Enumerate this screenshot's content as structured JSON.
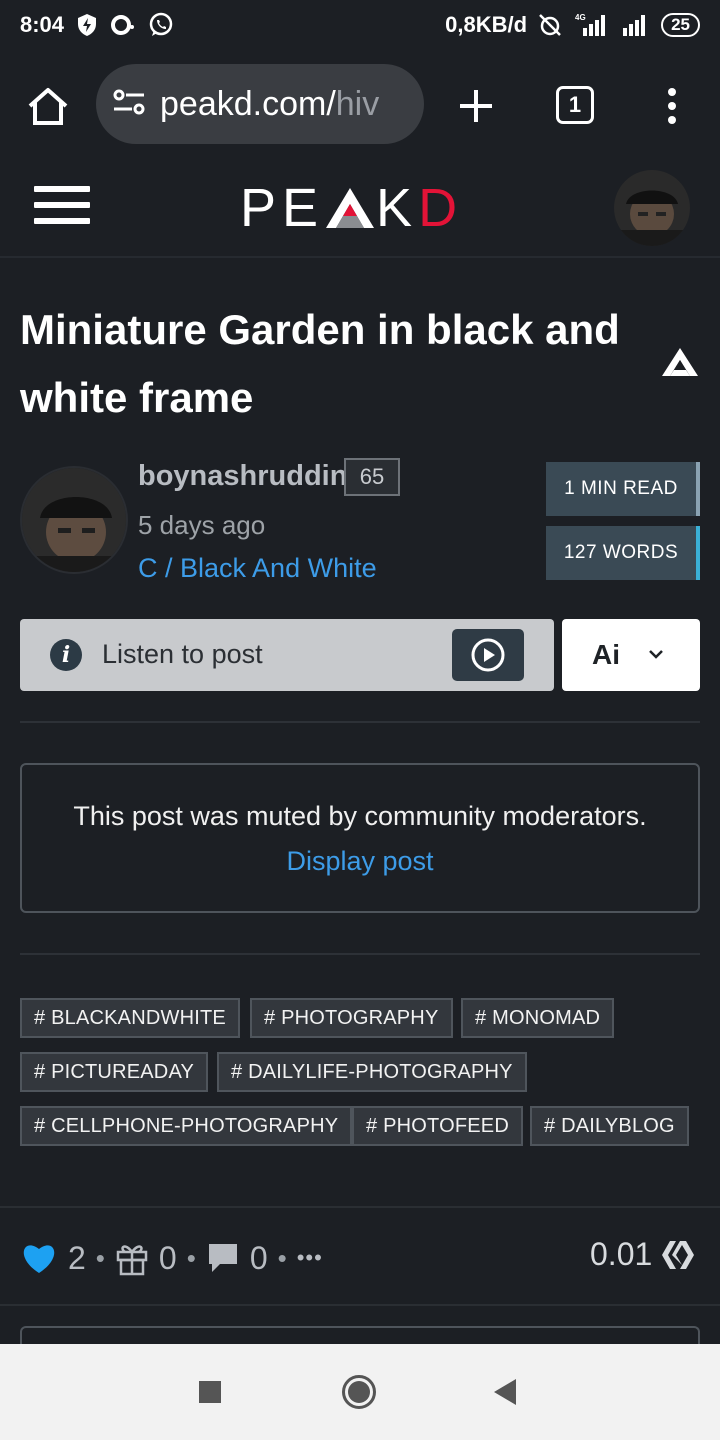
{
  "status_bar": {
    "time": "8:04",
    "network_speed": "0,8KB/d",
    "network_type": "4G",
    "battery": "25"
  },
  "browser": {
    "url_main": "peakd.com/",
    "url_rest": "hiv",
    "tab_count": "1"
  },
  "site": {
    "logo_pe": "PE",
    "logo_k": "K",
    "logo_d": "D"
  },
  "post": {
    "title": "Miniature Garden in black and white frame",
    "author": "boynashruddin",
    "reputation": "65",
    "time_ago": "5 days ago",
    "community": "C / Black And White",
    "read_time": "1 MIN READ",
    "word_count": "127 WORDS",
    "listen_label": "Listen to post",
    "ai_label": "Ai",
    "muted_message": "This post was muted by community moderators.",
    "display_post_label": "Display post"
  },
  "tags": [
    "# BLACKANDWHITE",
    "# PHOTOGRAPHY",
    "# MONOMAD",
    "# PICTUREADAY",
    "# DAILYLIFE-PHOTOGRAPHY",
    "# CELLPHONE-PHOTOGRAPHY",
    "# PHOTOFEED",
    "# DAILYBLOG"
  ],
  "actions": {
    "votes": "2",
    "tips": "0",
    "comments": "0",
    "more": "•••",
    "payout": "0.01"
  },
  "colors": {
    "background": "#1c1f24",
    "link": "#3d9ce8",
    "brand_red": "#e31337",
    "heart": "#1da1f2"
  }
}
